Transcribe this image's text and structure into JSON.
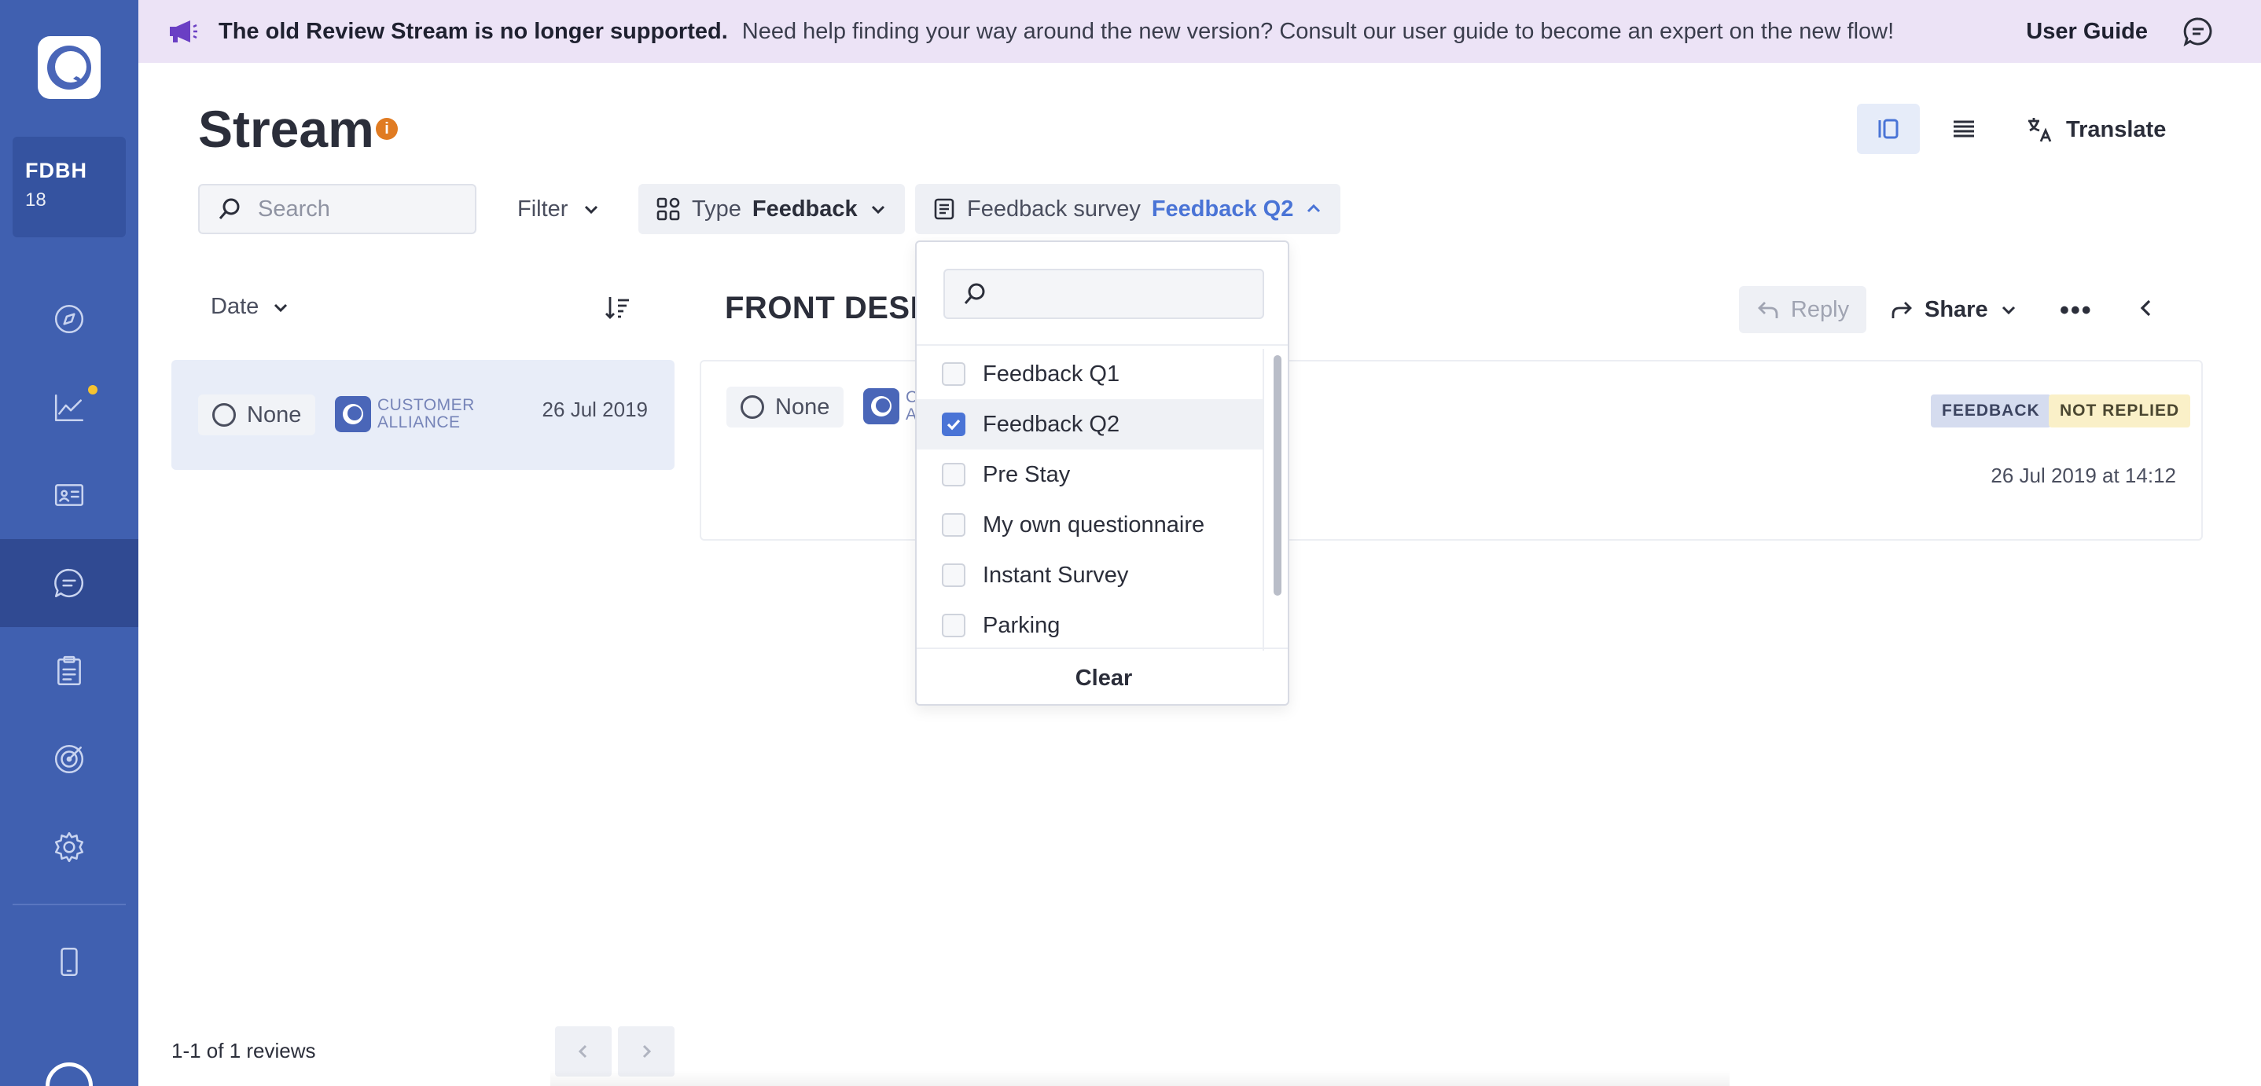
{
  "colors": {
    "sidebar": "#4060b0",
    "sidebar_active": "#304a92",
    "banner_bg": "#ece3f6",
    "accent_blue": "#4a74d6",
    "info_orange": "#e07b22"
  },
  "account": {
    "name": "FDBH",
    "number": "18"
  },
  "sidebar": {
    "items": [
      {
        "icon": "compass-icon"
      },
      {
        "icon": "chart-line-icon"
      },
      {
        "icon": "contact-card-icon"
      },
      {
        "icon": "chat-icon",
        "active": true
      },
      {
        "icon": "clipboard-icon"
      },
      {
        "icon": "target-icon"
      },
      {
        "icon": "gear-icon"
      },
      {
        "icon": "mobile-icon"
      }
    ]
  },
  "banner": {
    "strong_text": "The old Review Stream is no longer supported.",
    "text": "Need help finding your way around the new version? Consult our user guide to become an expert on the new flow!",
    "guide_link": "User Guide"
  },
  "header": {
    "title": "Stream",
    "info": "i",
    "translate_label": "Translate"
  },
  "filters": {
    "search_placeholder": "Search",
    "filter_label": "Filter",
    "type_label": "Type",
    "type_value": "Feedback",
    "survey_label": "Feedback survey",
    "survey_value": "Feedback Q2"
  },
  "list": {
    "sort_label": "Date",
    "review": {
      "status": "None",
      "brand_line1": "CUSTOMER",
      "brand_line2": "ALLIANCE",
      "date": "26 Jul 2019"
    },
    "count": "1-1 of 1 reviews"
  },
  "detail": {
    "title": "FRONT DESK",
    "reply_label": "Reply",
    "share_label": "Share",
    "more": "•••",
    "status": "None",
    "brand_line1": "C",
    "brand_line2": "A",
    "tags": [
      "FEEDBACK",
      "NOT REPLIED"
    ],
    "datetime": "26 Jul 2019 at 14:12"
  },
  "dropdown": {
    "options": [
      {
        "label": "Feedback Q1",
        "checked": false
      },
      {
        "label": "Feedback Q2",
        "checked": true
      },
      {
        "label": "Pre Stay",
        "checked": false
      },
      {
        "label": "My own questionnaire",
        "checked": false
      },
      {
        "label": "Instant Survey",
        "checked": false
      },
      {
        "label": "Parking",
        "checked": false
      }
    ],
    "clear_label": "Clear"
  }
}
